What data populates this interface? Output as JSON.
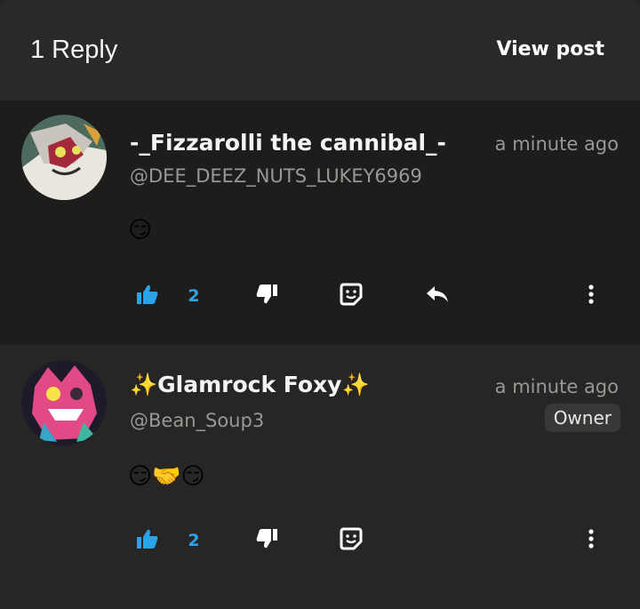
{
  "header": {
    "title": "1 Reply",
    "view_post_label": "View post"
  },
  "comments": [
    {
      "name": "-_Fizzarolli the cannibal_-",
      "handle": "@DEE_DEEZ_NUTS_LUKEY6969",
      "time": "a minute ago",
      "body": "😏",
      "like_count": "2",
      "actions": [
        "thumbs-up-icon",
        "thumbs-down-icon",
        "sticker-icon",
        "reply-icon",
        "more-icon"
      ]
    },
    {
      "name": "✨Glamrock Foxy✨",
      "handle": "@Bean_Soup3",
      "time": "a minute ago",
      "badge": "Owner",
      "body": "😏🤝😏",
      "like_count": "2",
      "actions": [
        "thumbs-up-icon",
        "thumbs-down-icon",
        "sticker-icon",
        "more-icon"
      ]
    }
  ],
  "colors": {
    "accent": "#2aa3e8",
    "background": "#1f1d1b",
    "text": "#f4f4f4",
    "muted": "#9a9896"
  }
}
